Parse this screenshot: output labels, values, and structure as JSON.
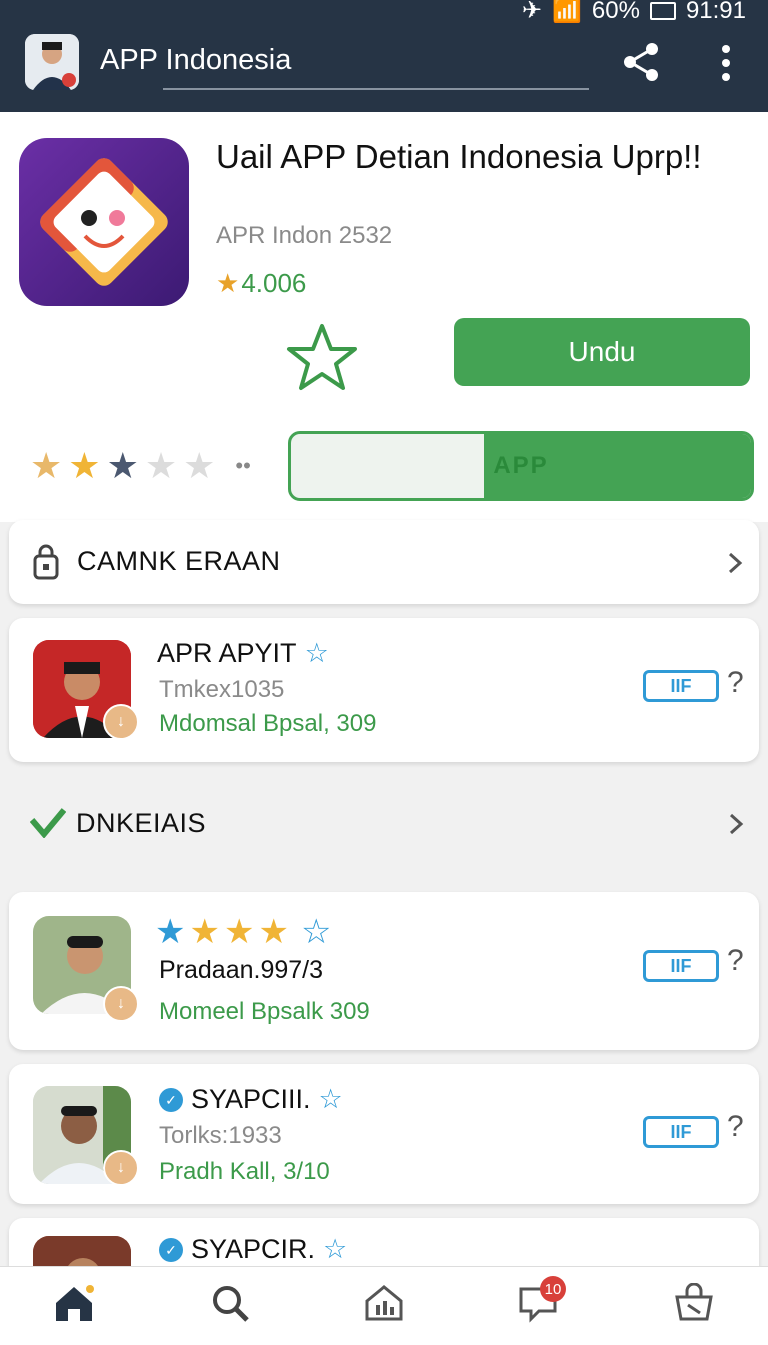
{
  "status_bar": {
    "battery": "60%",
    "time": "91:91"
  },
  "app_bar": {
    "title": "APP Indonesia"
  },
  "app": {
    "name": "Uail APP Detian Indonesia Uprp!!",
    "subtitle": "APR Indon 2532",
    "rating": "4.006",
    "install_label": "Undu",
    "progress_label": "APP",
    "progress_fraction": 0.42,
    "user_rating_stars": 2
  },
  "sections": {
    "first": {
      "title": "CAMNK ERAAN"
    },
    "second": {
      "title": "DNKEIAIS"
    }
  },
  "items": [
    {
      "name": "APR APYIT",
      "sub": "Tmkex1035",
      "green": "Mdomsal Bpsal, 309",
      "button": "IIF"
    },
    {
      "name": "Pradaan.997/3",
      "sub": "",
      "green": "Momeel Bpsalk 309",
      "button": "IIF",
      "stars": 4
    },
    {
      "name": "SYAPCIII.",
      "sub": "Torlks:1933",
      "green": "Pradh Kall, 3/10",
      "button": "IIF"
    },
    {
      "name": "SYAPCIR.",
      "sub": "",
      "green": "",
      "button": ""
    }
  ],
  "bottom_nav": {
    "notifications": "10"
  },
  "colors": {
    "primary_green": "#44a354",
    "appbar": "#263445",
    "accent_blue": "#2f9ad6"
  }
}
